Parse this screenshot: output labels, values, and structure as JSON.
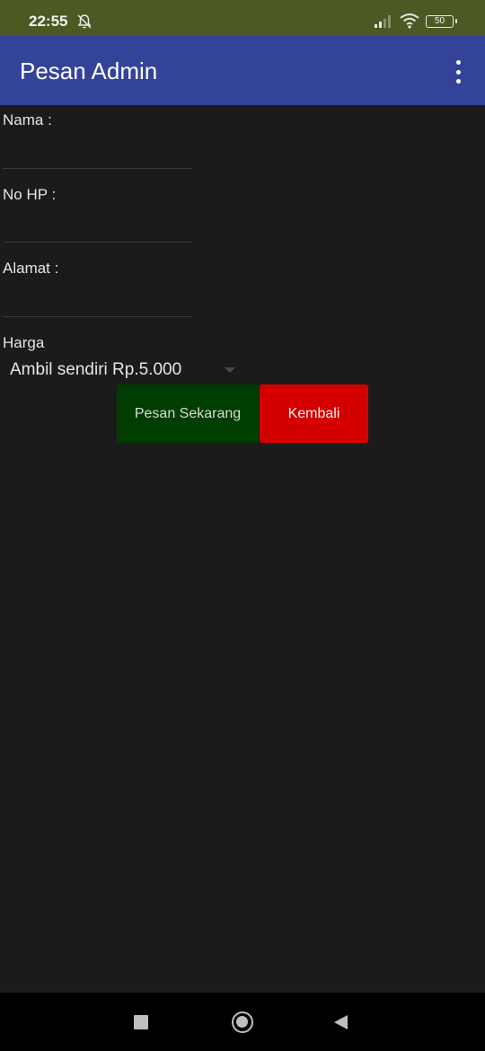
{
  "status_bar": {
    "time": "22:55",
    "battery": "50",
    "icons": [
      "alarm-off-icon",
      "signal-icon",
      "wifi-icon",
      "battery-icon"
    ]
  },
  "app_bar": {
    "title": "Pesan Admin",
    "menu_icon": "more-vert-icon"
  },
  "form": {
    "nama_label": "Nama :",
    "nama_value": "",
    "nohp_label": "No HP :",
    "nohp_value": "",
    "alamat_label": "Alamat :",
    "alamat_value": "",
    "harga_label": "Harga",
    "harga_selected": "Ambil sendiri Rp.5.000"
  },
  "buttons": {
    "order_label": "Pesan Sekarang",
    "back_label": "Kembali"
  },
  "colors": {
    "status_bar": "#4a5a22",
    "app_bar": "#34439a",
    "background": "#1b1b1b",
    "order_button": "#003d00",
    "back_button": "#d40000"
  },
  "nav_bar": {
    "icons": [
      "recent-apps-icon",
      "home-icon",
      "back-icon"
    ]
  }
}
